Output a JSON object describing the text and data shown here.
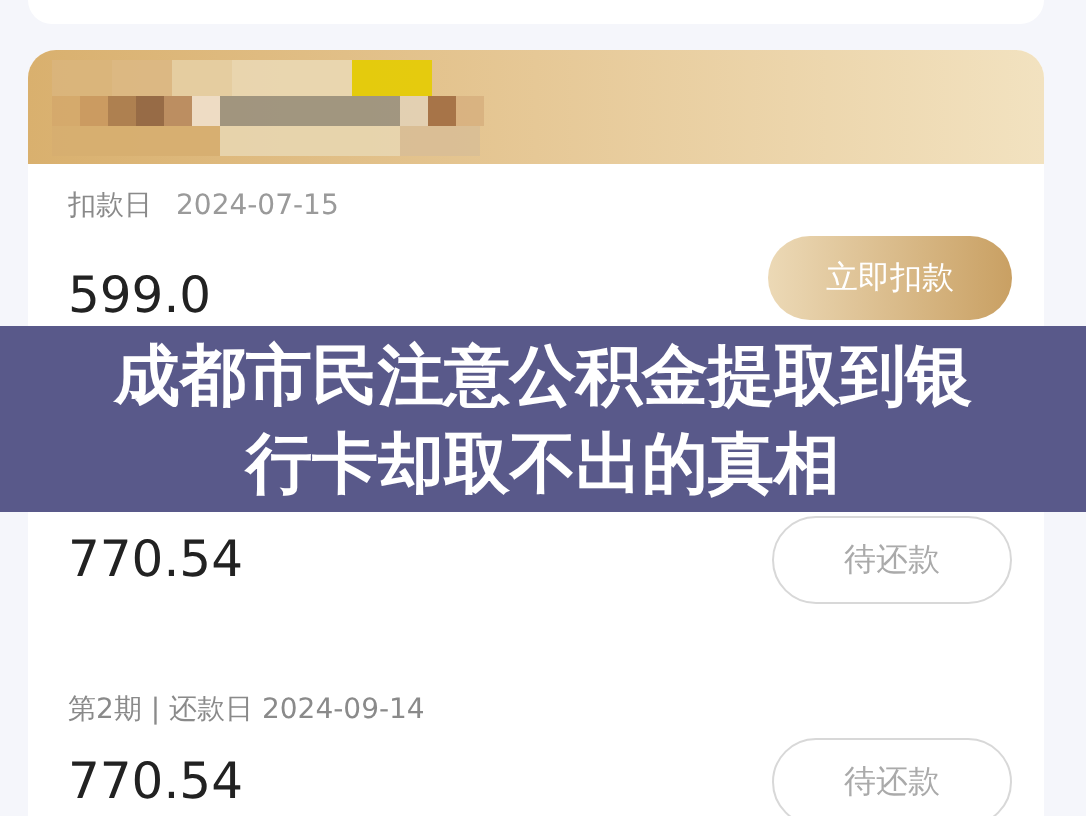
{
  "title_banner": {
    "text": "成都市民注意公积金提取到银行卡却取不出的真相"
  },
  "deduction": {
    "label": "扣款日",
    "date": "2024-07-15",
    "amount": "599.0",
    "button": "立即扣款"
  },
  "installments": [
    {
      "amount": "770.54",
      "status": "待还款"
    },
    {
      "label": "第2期 | 还款日 2024-09-14",
      "amount": "770.54",
      "status": "待还款"
    }
  ]
}
